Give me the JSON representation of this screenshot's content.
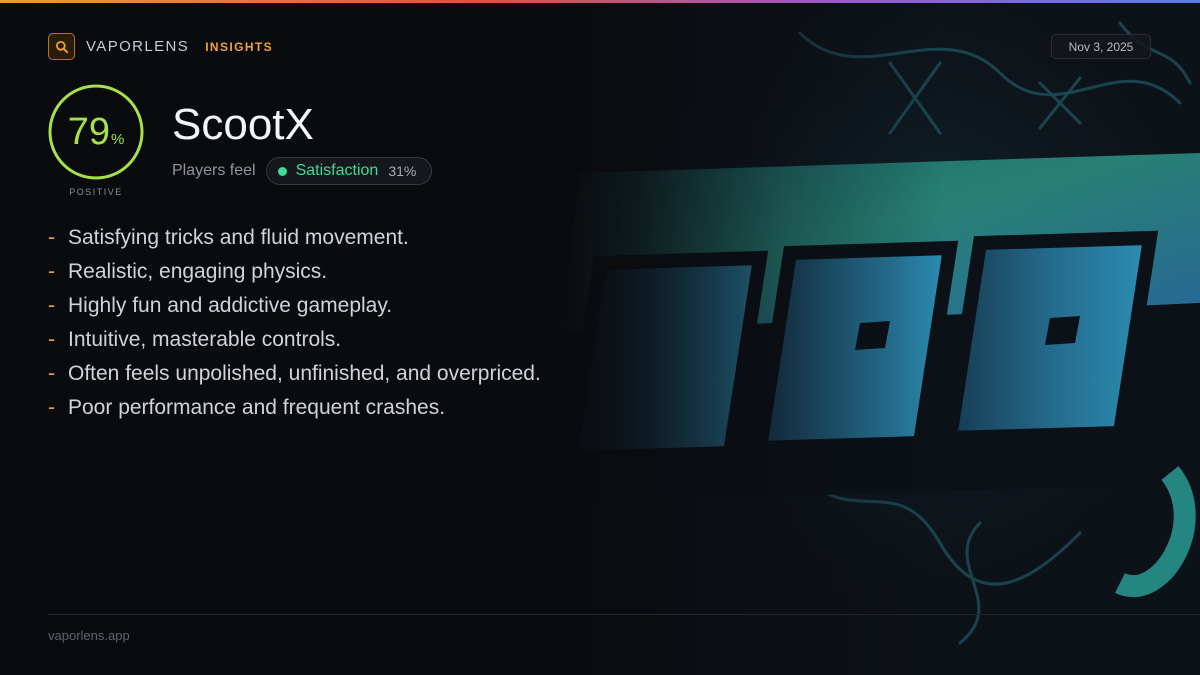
{
  "brand": {
    "name": "VAPORLENS",
    "tag": "INSIGHTS",
    "icon": "search-icon",
    "accent": "#f0a238"
  },
  "date": "Nov 3, 2025",
  "score": {
    "value": "79",
    "unit": "%",
    "label": "POSITIVE",
    "fraction": 0.79,
    "color": "#a6e04a"
  },
  "game": {
    "title": "ScootX"
  },
  "feel": {
    "label": "Players feel",
    "sentiment": "Satisfaction",
    "percent": "31%",
    "color": "#3ddc97"
  },
  "points": [
    "Satisfying tricks and fluid movement.",
    "Realistic, engaging physics.",
    "Highly fun and addictive gameplay.",
    "Intuitive, masterable controls.",
    "Often feels unpolished, unfinished, and overpriced.",
    "Poor performance and frequent crashes."
  ],
  "bullet": "-",
  "footer": {
    "site": "vaporlens.app"
  }
}
